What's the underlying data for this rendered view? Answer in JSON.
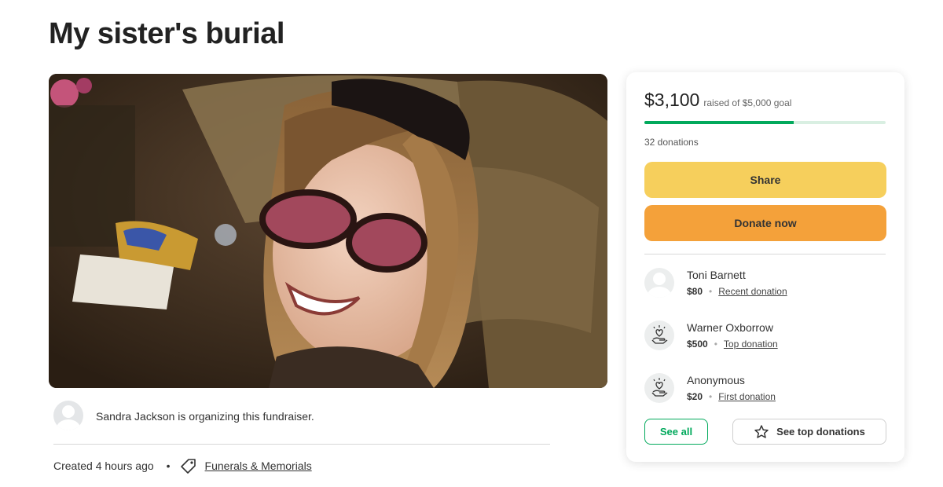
{
  "page": {
    "title": "My sister's burial"
  },
  "organizer": {
    "text": "Sandra Jackson is organizing this fundraiser."
  },
  "meta": {
    "created": "Created 4 hours ago",
    "separator": "•",
    "category": "Funerals & Memorials"
  },
  "sidebar": {
    "raised": "$3,100",
    "goal_text": "raised of $5,000 goal",
    "progress_fraction": 0.62,
    "donations_count": "32 donations",
    "share_label": "Share",
    "donate_label": "Donate now",
    "donors": [
      {
        "name": "Toni Barnett",
        "amount": "$80",
        "kind": "Recent donation",
        "icon": "avatar-icon"
      },
      {
        "name": "Warner Oxborrow",
        "amount": "$500",
        "kind": "Top donation",
        "icon": "donation-hand-icon"
      },
      {
        "name": "Anonymous",
        "amount": "$20",
        "kind": "First donation",
        "icon": "donation-hand-icon"
      }
    ],
    "see_all_label": "See all",
    "see_top_label": "See top donations"
  },
  "colors": {
    "brand_green": "#02a95c",
    "share_yellow": "#f6cf5c",
    "donate_orange": "#f4a13a"
  }
}
